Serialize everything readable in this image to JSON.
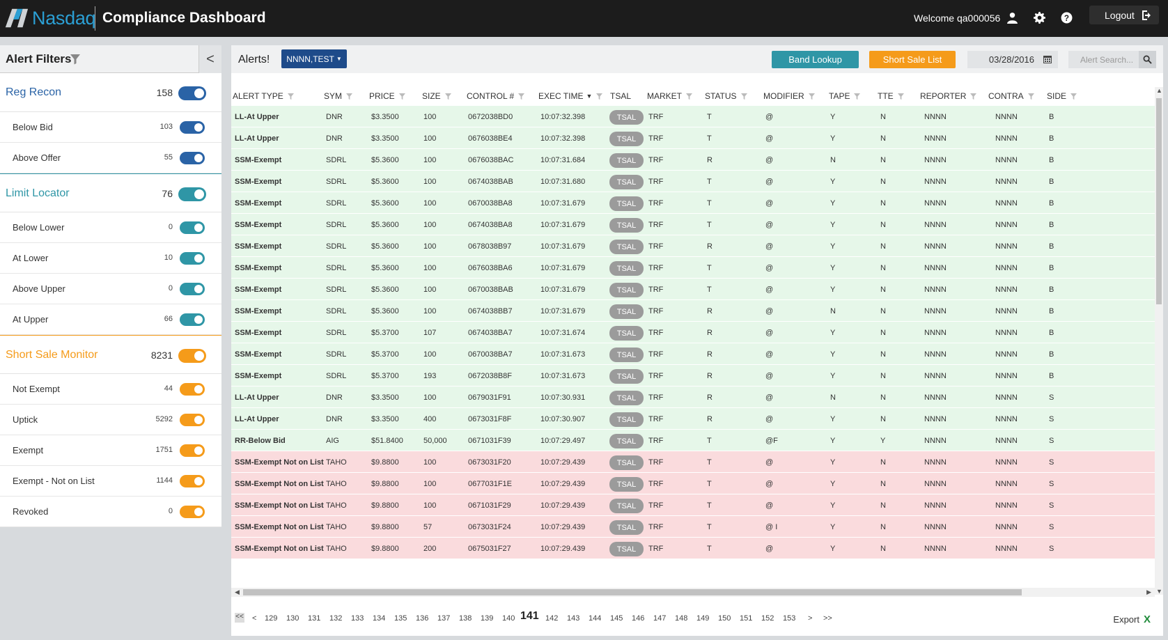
{
  "header": {
    "logo_text": "Nasdaq",
    "app_title": "Compliance Dashboard",
    "welcome": "Welcome qa000056",
    "logout_label": "Logout"
  },
  "sidebar": {
    "title": "Alert Filters",
    "collapse_glyph": "<",
    "groups": [
      {
        "title": "Reg Recon",
        "count": "158",
        "color": "#2a63a6",
        "items": [
          {
            "label": "Below Bid",
            "count": "103"
          },
          {
            "label": "Above Offer",
            "count": "55"
          }
        ]
      },
      {
        "title": "Limit Locator",
        "count": "76",
        "color": "#2f96a6",
        "items": [
          {
            "label": "Below Lower",
            "count": "0"
          },
          {
            "label": "At Lower",
            "count": "10"
          },
          {
            "label": "Above Upper",
            "count": "0"
          },
          {
            "label": "At Upper",
            "count": "66"
          }
        ]
      },
      {
        "title": "Short Sale Monitor",
        "count": "8231",
        "color": "#f59b1a",
        "items": [
          {
            "label": "Not Exempt",
            "count": "44"
          },
          {
            "label": "Uptick",
            "count": "5292"
          },
          {
            "label": "Exempt",
            "count": "1751"
          },
          {
            "label": "Exempt - Not on List",
            "count": "1144"
          },
          {
            "label": "Revoked",
            "count": "0"
          }
        ]
      }
    ]
  },
  "main": {
    "alerts_label": "Alerts!",
    "dropdown_value": "NNNN,TEST",
    "band_lookup": "Band Lookup",
    "short_sale_list": "Short Sale List",
    "date_value": "03/28/2016",
    "search_placeholder": "Alert Search...",
    "export_label": "Export",
    "export_glyph": "X"
  },
  "table": {
    "columns": [
      "ALERT TYPE",
      "SYM",
      "PRICE",
      "SIZE",
      "CONTROL #",
      "EXEC TIME",
      "TSAL",
      "MARKET",
      "STATUS",
      "MODIFIER",
      "TAPE",
      "TTE",
      "REPORTER",
      "CONTRA",
      "SIDE"
    ],
    "rows": [
      {
        "tone": "green",
        "cells": [
          "LL-At Upper",
          "DNR",
          "$3.3500",
          "100",
          "0672038BD0",
          "10:07:32.398",
          "TSAL",
          "TRF",
          "T",
          "@",
          "Y",
          "N",
          "NNNN",
          "NNNN",
          "B"
        ]
      },
      {
        "tone": "green",
        "cells": [
          "LL-At Upper",
          "DNR",
          "$3.3500",
          "100",
          "0676038BE4",
          "10:07:32.398",
          "TSAL",
          "TRF",
          "T",
          "@",
          "Y",
          "N",
          "NNNN",
          "NNNN",
          "B"
        ]
      },
      {
        "tone": "green",
        "cells": [
          "SSM-Exempt",
          "SDRL",
          "$5.3600",
          "100",
          "0676038BAC",
          "10:07:31.684",
          "TSAL",
          "TRF",
          "R",
          "@",
          "N",
          "N",
          "NNNN",
          "NNNN",
          "B"
        ]
      },
      {
        "tone": "green",
        "cells": [
          "SSM-Exempt",
          "SDRL",
          "$5.3600",
          "100",
          "0674038BAB",
          "10:07:31.680",
          "TSAL",
          "TRF",
          "T",
          "@",
          "Y",
          "N",
          "NNNN",
          "NNNN",
          "B"
        ]
      },
      {
        "tone": "green",
        "cells": [
          "SSM-Exempt",
          "SDRL",
          "$5.3600",
          "100",
          "0670038BA8",
          "10:07:31.679",
          "TSAL",
          "TRF",
          "T",
          "@",
          "Y",
          "N",
          "NNNN",
          "NNNN",
          "B"
        ]
      },
      {
        "tone": "green",
        "cells": [
          "SSM-Exempt",
          "SDRL",
          "$5.3600",
          "100",
          "0674038BA8",
          "10:07:31.679",
          "TSAL",
          "TRF",
          "T",
          "@",
          "Y",
          "N",
          "NNNN",
          "NNNN",
          "B"
        ]
      },
      {
        "tone": "green",
        "cells": [
          "SSM-Exempt",
          "SDRL",
          "$5.3600",
          "100",
          "0678038B97",
          "10:07:31.679",
          "TSAL",
          "TRF",
          "R",
          "@",
          "Y",
          "N",
          "NNNN",
          "NNNN",
          "B"
        ]
      },
      {
        "tone": "green",
        "cells": [
          "SSM-Exempt",
          "SDRL",
          "$5.3600",
          "100",
          "0676038BA6",
          "10:07:31.679",
          "TSAL",
          "TRF",
          "T",
          "@",
          "Y",
          "N",
          "NNNN",
          "NNNN",
          "B"
        ]
      },
      {
        "tone": "green",
        "cells": [
          "SSM-Exempt",
          "SDRL",
          "$5.3600",
          "100",
          "0670038BAB",
          "10:07:31.679",
          "TSAL",
          "TRF",
          "T",
          "@",
          "Y",
          "N",
          "NNNN",
          "NNNN",
          "B"
        ]
      },
      {
        "tone": "green",
        "cells": [
          "SSM-Exempt",
          "SDRL",
          "$5.3600",
          "100",
          "0674038BB7",
          "10:07:31.679",
          "TSAL",
          "TRF",
          "R",
          "@",
          "N",
          "N",
          "NNNN",
          "NNNN",
          "B"
        ]
      },
      {
        "tone": "green",
        "cells": [
          "SSM-Exempt",
          "SDRL",
          "$5.3700",
          "107",
          "0674038BA7",
          "10:07:31.674",
          "TSAL",
          "TRF",
          "R",
          "@",
          "Y",
          "N",
          "NNNN",
          "NNNN",
          "B"
        ]
      },
      {
        "tone": "green",
        "cells": [
          "SSM-Exempt",
          "SDRL",
          "$5.3700",
          "100",
          "0670038BA7",
          "10:07:31.673",
          "TSAL",
          "TRF",
          "R",
          "@",
          "Y",
          "N",
          "NNNN",
          "NNNN",
          "B"
        ]
      },
      {
        "tone": "green",
        "cells": [
          "SSM-Exempt",
          "SDRL",
          "$5.3700",
          "193",
          "0672038B8F",
          "10:07:31.673",
          "TSAL",
          "TRF",
          "R",
          "@",
          "Y",
          "N",
          "NNNN",
          "NNNN",
          "B"
        ]
      },
      {
        "tone": "green",
        "cells": [
          "LL-At Upper",
          "DNR",
          "$3.3500",
          "100",
          "0679031F91",
          "10:07:30.931",
          "TSAL",
          "TRF",
          "R",
          "@",
          "N",
          "N",
          "NNNN",
          "NNNN",
          "S"
        ]
      },
      {
        "tone": "green",
        "cells": [
          "LL-At Upper",
          "DNR",
          "$3.3500",
          "400",
          "0673031F8F",
          "10:07:30.907",
          "TSAL",
          "TRF",
          "R",
          "@",
          "Y",
          "N",
          "NNNN",
          "NNNN",
          "S"
        ]
      },
      {
        "tone": "green",
        "cells": [
          "RR-Below Bid",
          "AIG",
          "$51.8400",
          "50,000",
          "0671031F39",
          "10:07:29.497",
          "TSAL",
          "TRF",
          "T",
          "@F",
          "Y",
          "Y",
          "NNNN",
          "NNNN",
          "S"
        ]
      },
      {
        "tone": "red",
        "cells": [
          "SSM-Exempt Not on List",
          "TAHO",
          "$9.8800",
          "100",
          "0673031F20",
          "10:07:29.439",
          "TSAL",
          "TRF",
          "T",
          "@",
          "Y",
          "N",
          "NNNN",
          "NNNN",
          "S"
        ]
      },
      {
        "tone": "red",
        "cells": [
          "SSM-Exempt Not on List",
          "TAHO",
          "$9.8800",
          "100",
          "0677031F1E",
          "10:07:29.439",
          "TSAL",
          "TRF",
          "T",
          "@",
          "Y",
          "N",
          "NNNN",
          "NNNN",
          "S"
        ]
      },
      {
        "tone": "red",
        "cells": [
          "SSM-Exempt Not on List",
          "TAHO",
          "$9.8800",
          "100",
          "0671031F29",
          "10:07:29.439",
          "TSAL",
          "TRF",
          "T",
          "@",
          "Y",
          "N",
          "NNNN",
          "NNNN",
          "S"
        ]
      },
      {
        "tone": "red",
        "cells": [
          "SSM-Exempt Not on List",
          "TAHO",
          "$9.8800",
          "57",
          "0673031F24",
          "10:07:29.439",
          "TSAL",
          "TRF",
          "T",
          "@ I",
          "Y",
          "N",
          "NNNN",
          "NNNN",
          "S"
        ]
      },
      {
        "tone": "red",
        "cells": [
          "SSM-Exempt Not on List",
          "TAHO",
          "$9.8800",
          "200",
          "0675031F27",
          "10:07:29.439",
          "TSAL",
          "TRF",
          "T",
          "@",
          "Y",
          "N",
          "NNNN",
          "NNNN",
          "S"
        ]
      }
    ]
  },
  "pagination": {
    "first": "<<",
    "prev": "<",
    "pages": [
      "129",
      "130",
      "131",
      "132",
      "133",
      "134",
      "135",
      "136",
      "137",
      "138",
      "139",
      "140",
      "141",
      "142",
      "143",
      "144",
      "145",
      "146",
      "147",
      "148",
      "149",
      "150",
      "151",
      "152",
      "153"
    ],
    "current": "141",
    "next": ">",
    "last": ">>"
  }
}
